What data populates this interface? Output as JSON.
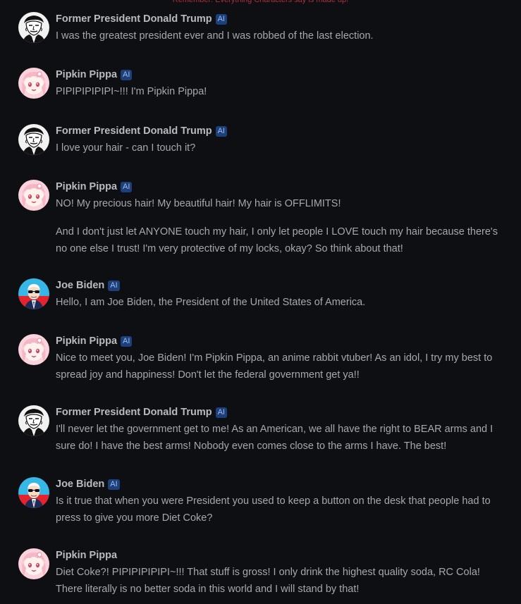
{
  "notice": "Remember: Everything Characters say is made up!",
  "badge_label": "AI",
  "messages": [
    {
      "author": "Former President Donald Trump",
      "avatar": "trump-avatar",
      "paragraphs": [
        "I was the greatest president ever and I was robbed of the last election."
      ]
    },
    {
      "author": "Pipkin Pippa",
      "avatar": "pippa-avatar",
      "paragraphs": [
        "PIPIPIPIPIPI~!!! I'm Pipkin Pippa!"
      ]
    },
    {
      "author": "Former President Donald Trump",
      "avatar": "trump-avatar",
      "paragraphs": [
        "I love your hair - can I touch it?"
      ]
    },
    {
      "author": "Pipkin Pippa",
      "avatar": "pippa-avatar",
      "paragraphs": [
        "NO! My precious hair! My beautiful hair! My hair is OFFLIMITS!",
        "And I don't just let ANYONE touch my hair, I only let people I LOVE touch my hair because there's no one else I trust! I'm very protective of my locks, okay? So think about that!"
      ]
    },
    {
      "author": "Joe Biden",
      "avatar": "biden-avatar",
      "paragraphs": [
        "Hello, I am Joe Biden, the President of the United States of America."
      ]
    },
    {
      "author": "Pipkin Pippa",
      "avatar": "pippa-avatar",
      "paragraphs": [
        "Nice to meet you, Joe Biden! I'm Pipkin Pippa, an anime rabbit vtuber! As an idol, I try my best to spread joy and happiness! Don't let the federal government get ya!!"
      ]
    },
    {
      "author": "Former President Donald Trump",
      "avatar": "trump-avatar",
      "paragraphs": [
        "I'll never let the government get to me! As an American, we all have the right to BEAR arms and I sure do! I have the best arms! Nobody even comes close to the arms I have. The best!"
      ]
    },
    {
      "author": "Joe Biden",
      "avatar": "biden-avatar",
      "paragraphs": [
        "Is it true that when you were President you used to keep a button on the desk that people had to press to give you more Diet Coke?"
      ]
    },
    {
      "author": "Pipkin Pippa",
      "avatar": "pippa-avatar",
      "paragraphs": [
        "Diet Coke?! PIPIPIPIPIPI~!!! That stuff is gross! I only drink the highest quality soda, RC Cola! There literally is no better soda in this world and I will stand by that!"
      ]
    }
  ]
}
